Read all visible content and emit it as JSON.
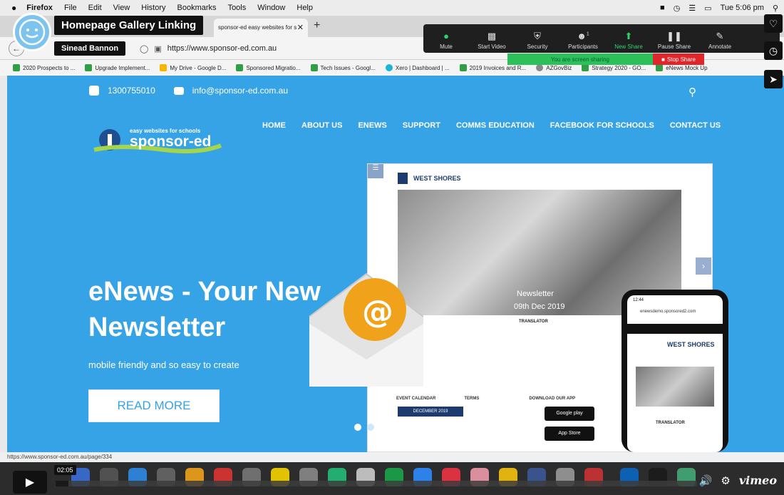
{
  "menubar": {
    "items": [
      "Firefox",
      "File",
      "Edit",
      "View",
      "History",
      "Bookmarks",
      "Tools",
      "Window",
      "Help"
    ],
    "clock": "Tue 5:06 pm"
  },
  "browser": {
    "tab_title": "sponsor-ed easy websites for s",
    "url": "https://www.sponsor-ed.com.au",
    "bookmarks": [
      "2020 Prospects to ...",
      "Upgrade Implement...",
      "My Drive - Google D...",
      "Sponsored Migratio...",
      "Tech Issues - Googl...",
      "Xero | Dashboard | ...",
      "2019 Invoices and R...",
      "AZGovBiz",
      "Strategy 2020 - GO...",
      "eNews Mock Up"
    ],
    "status_url": "https://www.sponsor-ed.com.au/page/334"
  },
  "zoom": {
    "buttons": [
      {
        "label": "Mute",
        "icon": "microphone-icon"
      },
      {
        "label": "Start Video",
        "icon": "video-off-icon"
      },
      {
        "label": "Security",
        "icon": "shield-icon"
      },
      {
        "label": "Participants",
        "icon": "participants-icon",
        "count": "1"
      },
      {
        "label": "New Share",
        "icon": "share-up-icon",
        "accent": "#2fd36b"
      },
      {
        "label": "Pause Share",
        "icon": "pause-icon"
      },
      {
        "label": "Annotate",
        "icon": "pencil-icon"
      }
    ],
    "sharing_text": "You are screen sharing",
    "stop_share": "Stop Share"
  },
  "video": {
    "title": "Homepage Gallery Linking",
    "author": "Sinead Bannon",
    "timecode": "02:05",
    "brand": "vimeo",
    "progress_fraction": 0.02
  },
  "site": {
    "phone": "1300755010",
    "email": "info@sponsor-ed.com.au",
    "logo_tagline": "easy websites for schools",
    "logo_name": "sponsor-ed",
    "nav": [
      "HOME",
      "ABOUT US",
      "ENEWS",
      "SUPPORT",
      "COMMS EDUCATION",
      "FACEBOOK FOR SCHOOLS",
      "CONTACT US"
    ],
    "headline_line1": "eNews - Your New",
    "headline_line2": "Newsletter",
    "subtext": "mobile friendly and so easy to create",
    "cta": "READ MORE",
    "accent": "#36a3e6",
    "mockup": {
      "school": "WEST SHORES",
      "newsletter": "Newsletter",
      "date": "09th Dec 2019",
      "translator": "TRANSLATOR",
      "event_calendar": "EVENT CALENDAR",
      "terms": "TERMS",
      "download_app": "DOWNLOAD OUR APP",
      "calendar_month": "DECEMBER 2019",
      "google_play": "Google play",
      "app_store": "App Store",
      "phone_url": "enewsdemo.sponsored2.com",
      "phone_time": "12:44"
    }
  }
}
